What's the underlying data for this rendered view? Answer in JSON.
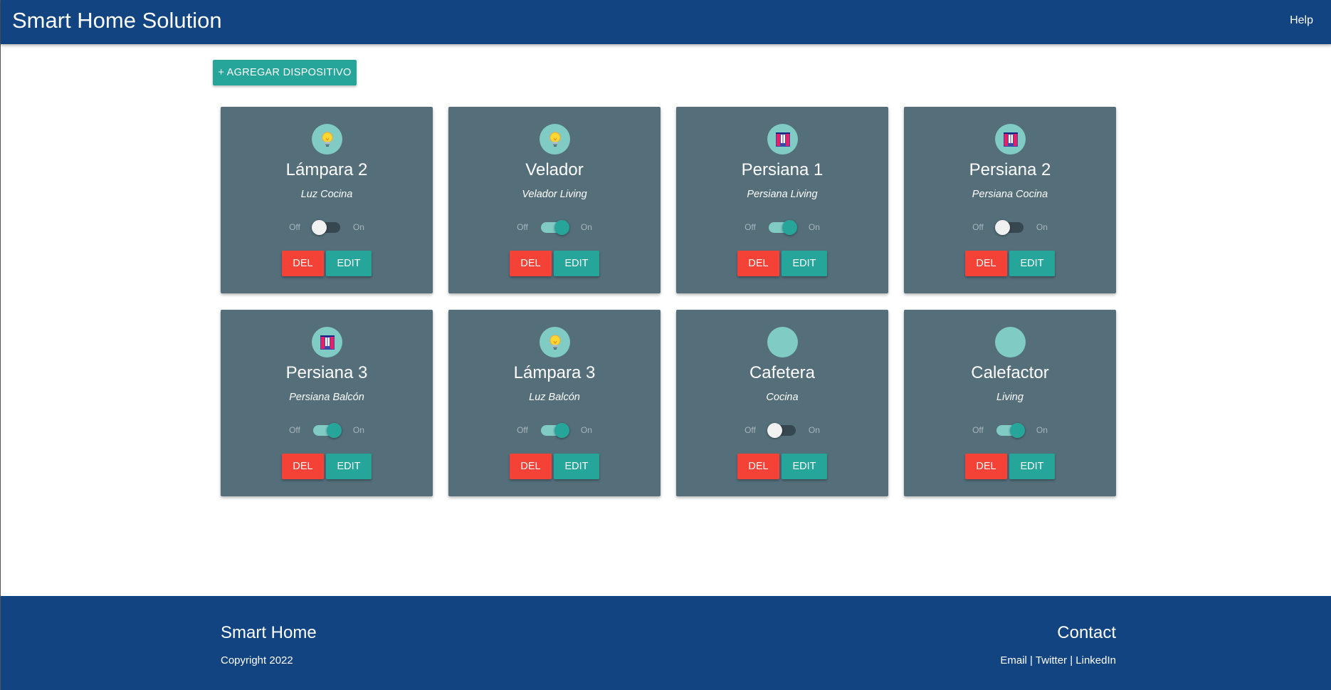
{
  "header": {
    "title": "Smart Home Solution",
    "help_label": "Help"
  },
  "toolbar": {
    "add_label": "+ AGREGAR DISPOSITIVO"
  },
  "labels": {
    "off": "Off",
    "on": "On",
    "del": "DEL",
    "edit": "EDIT"
  },
  "devices": [
    {
      "name": "Lámpara 2",
      "description": "Luz Cocina",
      "icon": "lightbulb-icon",
      "state": false
    },
    {
      "name": "Velador",
      "description": "Velador Living",
      "icon": "lightbulb-icon",
      "state": true
    },
    {
      "name": "Persiana 1",
      "description": "Persiana Living",
      "icon": "window-blind-icon",
      "state": true
    },
    {
      "name": "Persiana 2",
      "description": "Persiana Cocina",
      "icon": "window-blind-icon",
      "state": false
    },
    {
      "name": "Persiana 3",
      "description": "Persiana Balcón",
      "icon": "window-blind-icon",
      "state": true
    },
    {
      "name": "Lámpara 3",
      "description": "Luz Balcón",
      "icon": "lightbulb-icon",
      "state": true
    },
    {
      "name": "Cafetera",
      "description": "Cocina",
      "icon": "blank-icon",
      "state": false
    },
    {
      "name": "Calefactor",
      "description": "Living",
      "icon": "blank-icon",
      "state": true
    }
  ],
  "footer": {
    "left_title": "Smart Home",
    "copyright": "Copyright 2022",
    "right_title": "Contact",
    "links": [
      "Email",
      "Twitter",
      "LinkedIn"
    ],
    "separator": " | "
  },
  "colors": {
    "navbar": "#124481",
    "card": "#546e7a",
    "accent": "#26a69a",
    "danger": "#f44336",
    "icon_circle": "#80cbc4"
  }
}
